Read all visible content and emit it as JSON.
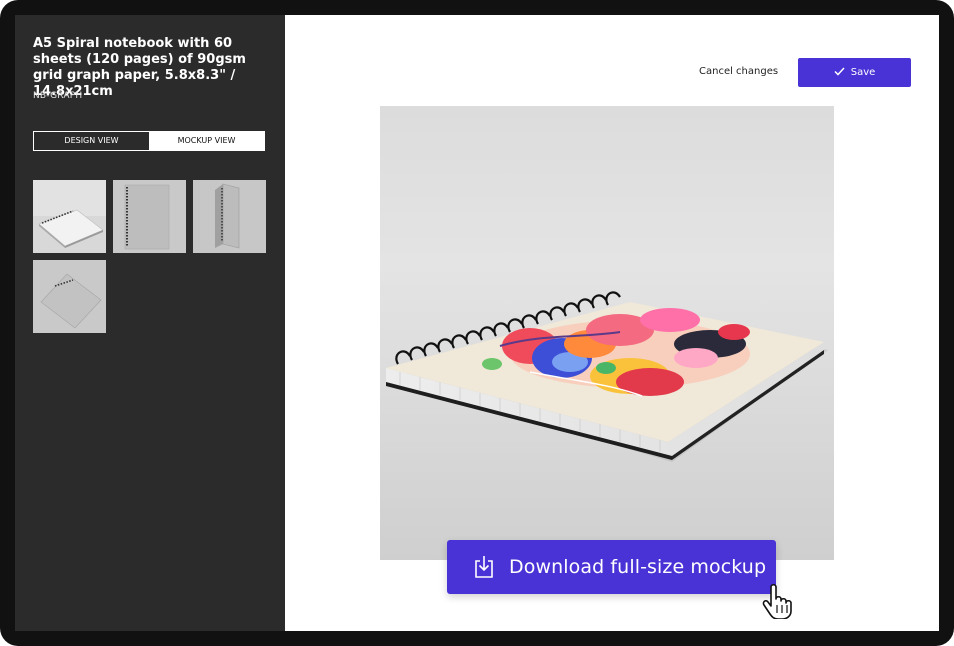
{
  "sidebar": {
    "product_title": "A5 Spiral notebook with 60 sheets (120 pages) of 90gsm grid graph paper, 5.8x8.3\" / 14.8x21cm",
    "sku": "NB-GRAPH",
    "view_tabs": [
      {
        "label": "DESIGN VIEW",
        "active": false
      },
      {
        "label": "MOCKUP VIEW",
        "active": true
      }
    ],
    "thumbnails": [
      "notebook-angle-view",
      "notebook-front-view",
      "notebook-side-view",
      "notebook-top-view"
    ]
  },
  "header": {
    "cancel_label": "Cancel changes",
    "save_label": "Save"
  },
  "main": {
    "download_label": "Download full-size mockup"
  },
  "colors": {
    "accent": "#4a33d6",
    "sidebar_bg": "#2b2b2b",
    "frame": "#111111"
  },
  "icons": [
    "check-icon",
    "download-icon",
    "hand-cursor-icon"
  ]
}
